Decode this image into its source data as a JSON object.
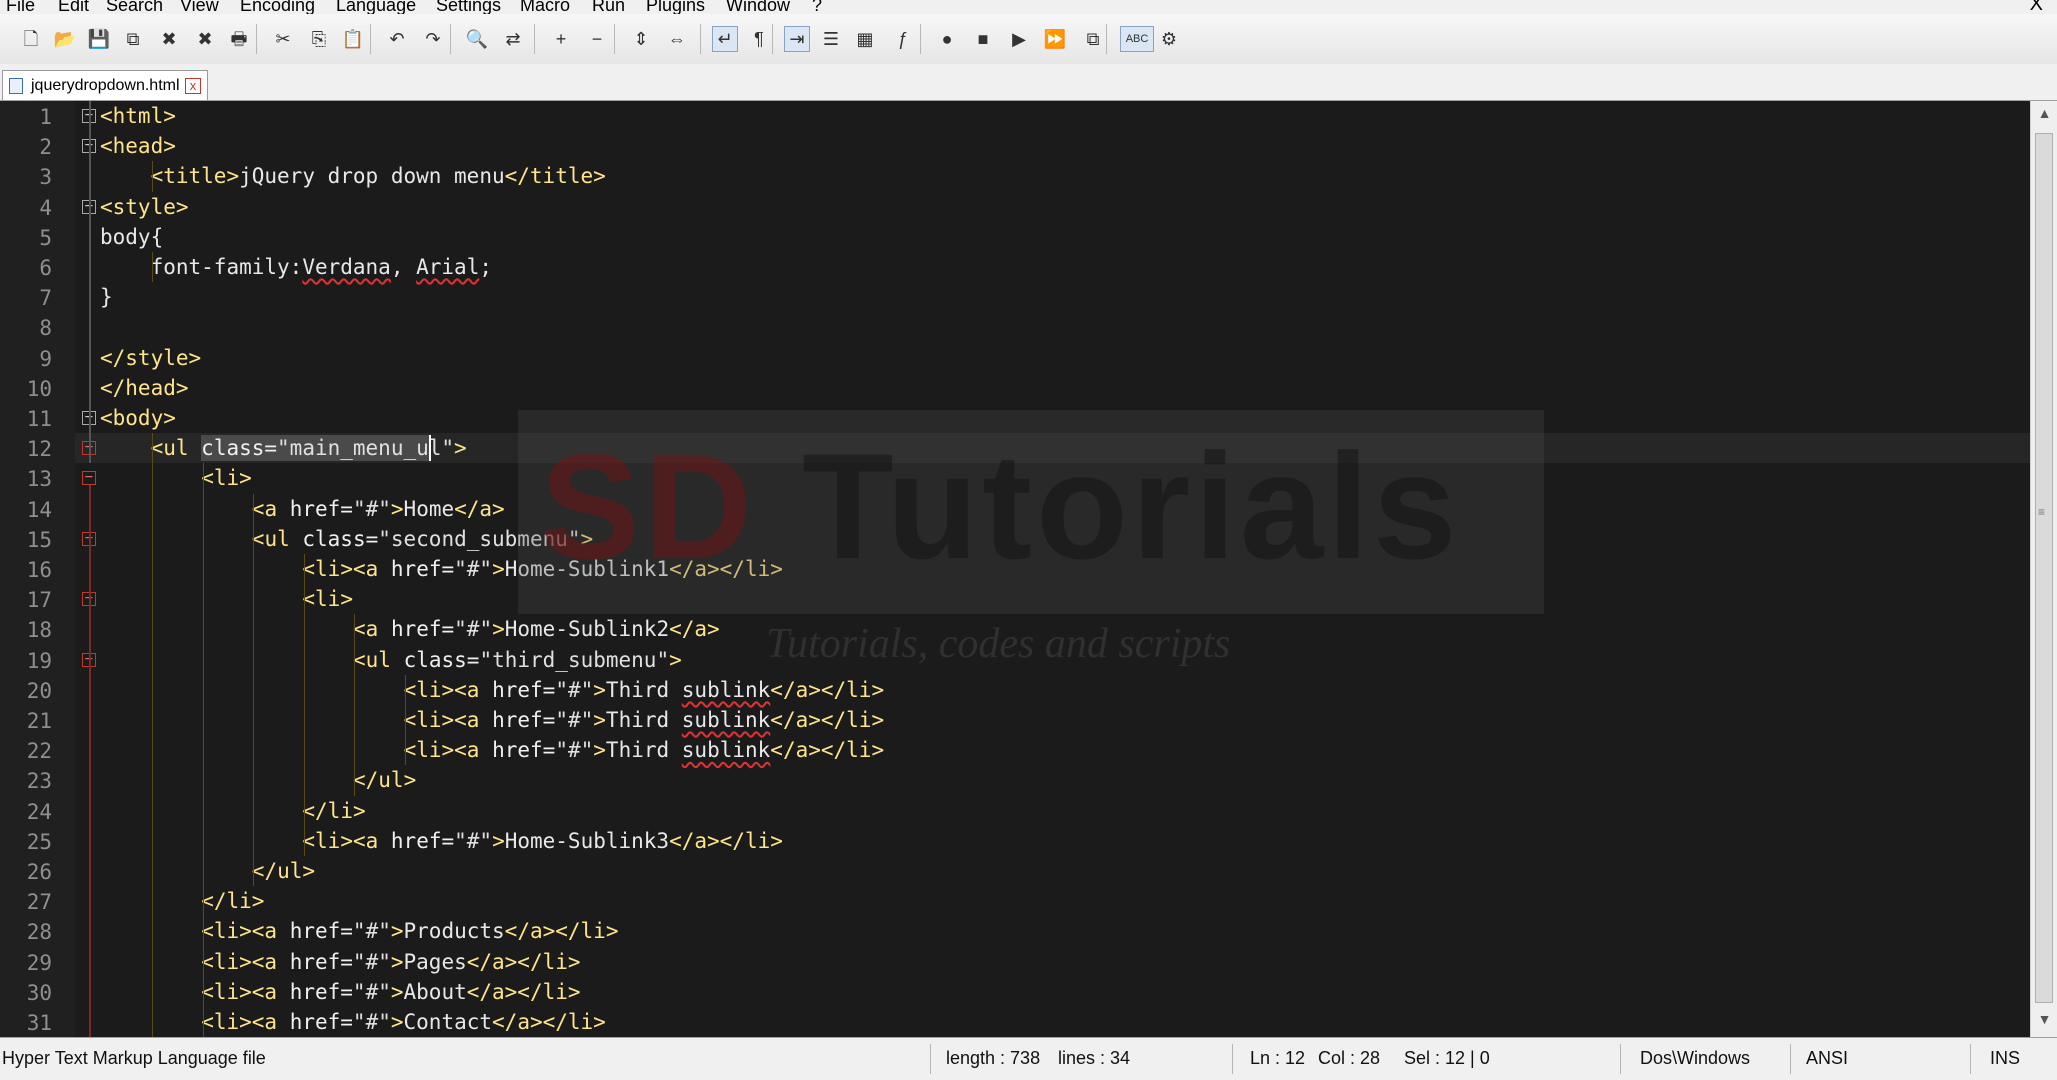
{
  "menu": [
    "File",
    "Edit",
    "Search",
    "View",
    "Encoding",
    "Language",
    "Settings",
    "Macro",
    "Run",
    "Plugins",
    "Window",
    "?"
  ],
  "window_close": "X",
  "toolbar": {
    "icons": [
      "new-file-icon",
      "open-file-icon",
      "save-icon",
      "save-all-icon",
      "close-icon",
      "close-all-icon",
      "print-icon",
      "cut-icon",
      "copy-icon",
      "paste-icon",
      "undo-icon",
      "redo-icon",
      "find-icon",
      "replace-icon",
      "zoom-in-icon",
      "zoom-out-icon",
      "sync-vertical-icon",
      "sync-horizontal-icon",
      "word-wrap-icon",
      "show-all-chars-icon",
      "indent-guide-icon",
      "user-language-icon",
      "doc-map-icon",
      "function-list-icon",
      "record-macro-icon",
      "stop-record-icon",
      "playback-macro-icon",
      "run-macro-multiple-icon",
      "save-macro-icon",
      "spell-check-icon",
      "preferences-icon"
    ],
    "glyphs": [
      "🗋",
      "📂",
      "💾",
      "⧉",
      "✖",
      "✖",
      "🖶",
      "✂",
      "⎘",
      "📋",
      "↶",
      "↷",
      "🔍",
      "⇄",
      "+",
      "−",
      "⇕",
      "⇔",
      "↵",
      "¶",
      "⇥",
      "☰",
      "▦",
      "ƒ",
      "●",
      "■",
      "▶",
      "⏩",
      "⧉",
      "ABC",
      "⚙"
    ]
  },
  "tab": {
    "label": "jquerydropdown.html",
    "close": "x"
  },
  "editor": {
    "lines": [
      {
        "n": "1",
        "indent": 0,
        "tokens": [
          [
            "tag",
            "<html>"
          ]
        ]
      },
      {
        "n": "2",
        "indent": 0,
        "tokens": [
          [
            "tag",
            "<head>"
          ]
        ]
      },
      {
        "n": "3",
        "indent": 1,
        "tokens": [
          [
            "tag",
            "<title>"
          ],
          [
            "text",
            "jQuery drop down menu"
          ],
          [
            "tag",
            "</title>"
          ]
        ]
      },
      {
        "n": "4",
        "indent": 0,
        "tokens": [
          [
            "tag",
            "<style>"
          ]
        ]
      },
      {
        "n": "5",
        "indent": 0,
        "tokens": [
          [
            "text",
            "body{"
          ]
        ]
      },
      {
        "n": "6",
        "indent": 1,
        "tokens": [
          [
            "text",
            "font-family:"
          ],
          [
            "sq",
            "Verdana"
          ],
          [
            "text",
            ", "
          ],
          [
            "sq",
            "Arial"
          ],
          [
            "text",
            ";"
          ]
        ]
      },
      {
        "n": "7",
        "indent": 0,
        "tokens": [
          [
            "text",
            "}"
          ]
        ]
      },
      {
        "n": "8",
        "indent": 0,
        "tokens": []
      },
      {
        "n": "9",
        "indent": 0,
        "tokens": [
          [
            "tag",
            "</style>"
          ]
        ]
      },
      {
        "n": "10",
        "indent": 0,
        "tokens": [
          [
            "tag",
            "</head>"
          ]
        ]
      },
      {
        "n": "11",
        "indent": 0,
        "tokens": [
          [
            "tag",
            "<body>"
          ]
        ]
      },
      {
        "n": "12",
        "indent": 1,
        "tokens": [
          [
            "tag",
            "<ul "
          ],
          [
            "attr",
            "class="
          ],
          [
            "str",
            "\"main_menu_ul\""
          ],
          [
            "tag",
            ">"
          ]
        ]
      },
      {
        "n": "13",
        "indent": 2,
        "tokens": [
          [
            "tag",
            "<li>"
          ]
        ]
      },
      {
        "n": "14",
        "indent": 3,
        "tokens": [
          [
            "tag",
            "<a "
          ],
          [
            "attr",
            "href="
          ],
          [
            "str",
            "\"#\""
          ],
          [
            "tag",
            ">"
          ],
          [
            "text",
            "Home"
          ],
          [
            "tag",
            "</a>"
          ]
        ]
      },
      {
        "n": "15",
        "indent": 3,
        "tokens": [
          [
            "tag",
            "<ul "
          ],
          [
            "attr",
            "class="
          ],
          [
            "str",
            "\"second_submenu\""
          ],
          [
            "tag",
            ">"
          ]
        ]
      },
      {
        "n": "16",
        "indent": 4,
        "tokens": [
          [
            "tag",
            "<li><a "
          ],
          [
            "attr",
            "href="
          ],
          [
            "str",
            "\"#\""
          ],
          [
            "tag",
            ">"
          ],
          [
            "text",
            "Home-Sublink1"
          ],
          [
            "tag",
            "</a></li>"
          ]
        ]
      },
      {
        "n": "17",
        "indent": 4,
        "tokens": [
          [
            "tag",
            "<li>"
          ]
        ]
      },
      {
        "n": "18",
        "indent": 5,
        "tokens": [
          [
            "tag",
            "<a "
          ],
          [
            "attr",
            "href="
          ],
          [
            "str",
            "\"#\""
          ],
          [
            "tag",
            ">"
          ],
          [
            "text",
            "Home-Sublink2"
          ],
          [
            "tag",
            "</a>"
          ]
        ]
      },
      {
        "n": "19",
        "indent": 5,
        "tokens": [
          [
            "tag",
            "<ul "
          ],
          [
            "attr",
            "class="
          ],
          [
            "str",
            "\"third_submenu\""
          ],
          [
            "tag",
            ">"
          ]
        ]
      },
      {
        "n": "20",
        "indent": 6,
        "tokens": [
          [
            "tag",
            "<li><a "
          ],
          [
            "attr",
            "href="
          ],
          [
            "str",
            "\"#\""
          ],
          [
            "tag",
            ">"
          ],
          [
            "text",
            "Third "
          ],
          [
            "sq",
            "sublink"
          ],
          [
            "tag",
            "</a></li>"
          ]
        ]
      },
      {
        "n": "21",
        "indent": 6,
        "tokens": [
          [
            "tag",
            "<li><a "
          ],
          [
            "attr",
            "href="
          ],
          [
            "str",
            "\"#\""
          ],
          [
            "tag",
            ">"
          ],
          [
            "text",
            "Third "
          ],
          [
            "sq",
            "sublink"
          ],
          [
            "tag",
            "</a></li>"
          ]
        ]
      },
      {
        "n": "22",
        "indent": 6,
        "tokens": [
          [
            "tag",
            "<li><a "
          ],
          [
            "attr",
            "href="
          ],
          [
            "str",
            "\"#\""
          ],
          [
            "tag",
            ">"
          ],
          [
            "text",
            "Third "
          ],
          [
            "sq",
            "sublink"
          ],
          [
            "tag",
            "</a></li>"
          ]
        ]
      },
      {
        "n": "23",
        "indent": 5,
        "tokens": [
          [
            "tag",
            "</ul>"
          ]
        ]
      },
      {
        "n": "24",
        "indent": 4,
        "tokens": [
          [
            "tag",
            "</li>"
          ]
        ]
      },
      {
        "n": "25",
        "indent": 4,
        "tokens": [
          [
            "tag",
            "<li><a "
          ],
          [
            "attr",
            "href="
          ],
          [
            "str",
            "\"#\""
          ],
          [
            "tag",
            ">"
          ],
          [
            "text",
            "Home-Sublink3"
          ],
          [
            "tag",
            "</a></li>"
          ]
        ]
      },
      {
        "n": "26",
        "indent": 3,
        "tokens": [
          [
            "tag",
            "</ul>"
          ]
        ]
      },
      {
        "n": "27",
        "indent": 2,
        "tokens": [
          [
            "tag",
            "</li>"
          ]
        ]
      },
      {
        "n": "28",
        "indent": 2,
        "tokens": [
          [
            "tag",
            "<li><a "
          ],
          [
            "attr",
            "href="
          ],
          [
            "str",
            "\"#\""
          ],
          [
            "tag",
            ">"
          ],
          [
            "text",
            "Products"
          ],
          [
            "tag",
            "</a></li>"
          ]
        ]
      },
      {
        "n": "29",
        "indent": 2,
        "tokens": [
          [
            "tag",
            "<li><a "
          ],
          [
            "attr",
            "href="
          ],
          [
            "str",
            "\"#\""
          ],
          [
            "tag",
            ">"
          ],
          [
            "text",
            "Pages"
          ],
          [
            "tag",
            "</a></li>"
          ]
        ]
      },
      {
        "n": "30",
        "indent": 2,
        "tokens": [
          [
            "tag",
            "<li><a "
          ],
          [
            "attr",
            "href="
          ],
          [
            "str",
            "\"#\""
          ],
          [
            "tag",
            ">"
          ],
          [
            "text",
            "About"
          ],
          [
            "tag",
            "</a></li>"
          ]
        ]
      },
      {
        "n": "31",
        "indent": 2,
        "tokens": [
          [
            "tag",
            "<li><a "
          ],
          [
            "attr",
            "href="
          ],
          [
            "str",
            "\"#\""
          ],
          [
            "tag",
            ">"
          ],
          [
            "text",
            "Contact"
          ],
          [
            "tag",
            "</a></li>"
          ]
        ]
      }
    ],
    "fold_open": [
      "1",
      "2",
      "4",
      "11"
    ],
    "fold_open_red": [
      "12",
      "13",
      "15",
      "17",
      "19"
    ]
  },
  "watermark": {
    "title_a": "SD",
    "title_b": " Tutorials",
    "subtitle": "Tutorials, codes and scripts"
  },
  "status": {
    "file_type": "Hyper Text Markup Language file",
    "length": "length : 738",
    "lines": "lines : 34",
    "ln": "Ln : 12",
    "col": "Col : 28",
    "sel": "Sel : 12 | 0",
    "eol": "Dos\\Windows",
    "encoding": "ANSI",
    "mode": "INS"
  }
}
